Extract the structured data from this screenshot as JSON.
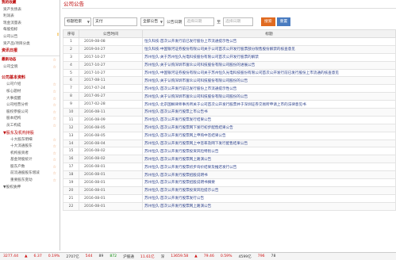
{
  "sidebar": {
    "top_items": [
      {
        "label": "我的收藏",
        "bold": true
      },
      {
        "label": "资产负债表"
      },
      {
        "label": "利润表"
      },
      {
        "label": "现金流量表"
      },
      {
        "label": "每股指标"
      },
      {
        "label": "公司公告"
      },
      {
        "label": "资产品/项目分类"
      }
    ],
    "info_section": "资讯日报",
    "mid_items": [
      {
        "label": "最新动态",
        "bold": true,
        "star": true
      },
      {
        "label": "公司全貌",
        "star": true
      }
    ],
    "basic_section": "公司基本资料",
    "basic_items": [
      {
        "label": "公司介绍",
        "star": true
      },
      {
        "label": "核心题材",
        "star": true
      },
      {
        "label": "大事提醒",
        "star": true
      },
      {
        "label": "公司经营分析",
        "star": true
      },
      {
        "label": "股权参股公司",
        "star": true
      },
      {
        "label": "股本结构",
        "star": true
      },
      {
        "label": "员工构成",
        "star": true
      }
    ],
    "shareholder_section": "▼股东及机构持股",
    "shareholder_items": [
      {
        "label": "十大股东明细",
        "star": true
      },
      {
        "label": "十大流通股东",
        "star": true
      },
      {
        "label": "机构投资者",
        "star": true
      },
      {
        "label": "基金持股统计",
        "star": true
      },
      {
        "label": "股东户数",
        "star": true
      },
      {
        "label": "前流通股股东增减",
        "star": true
      },
      {
        "label": "重要股东变动",
        "star": true
      }
    ],
    "bottom_item": "▼股权质押",
    "scroll_marker": "⇕"
  },
  "main": {
    "title": "公司公告",
    "filters": {
      "field_select": "标题检索",
      "keyword": "支付",
      "category_select": "全部公告",
      "date_label": "公告日期",
      "start_date_placeholder": "选择日期",
      "to_label": "至",
      "end_date_placeholder": "选择日期",
      "search_button": "搜索",
      "reset_button": "重置"
    },
    "table": {
      "headers": [
        "序号",
        "公告时间",
        "标题"
      ],
      "rows": [
        {
          "num": "1",
          "date": "2019-08-08",
          "title": "恒久科技:首次公开发行前已发行股份上市流通提示性公告"
        },
        {
          "num": "2",
          "date": "2019-04-27",
          "title": "恒久科技:中国银河证券股份有限公司关于公司首次公开发行股票部分限售股份解禁的核查意见"
        },
        {
          "num": "3",
          "date": "2017-10-27",
          "title": "苏州恒久:关于苏州恒久光电科技股份有限公司首次公开发行股票的解禁"
        },
        {
          "num": "4",
          "date": "2017-10-27",
          "title": "苏州恒久:关于认购深圳市富众公司科技股份有限公司股份的进展公告"
        },
        {
          "num": "5",
          "date": "2017-10-27",
          "title": "苏州恒久:中国银河证券股份有限公司关于苏州恒久光电科技股份有限公司首次公开发行前已发行股份上市流通的核查意见"
        },
        {
          "num": "6",
          "date": "2017-08-11",
          "title": "苏州恒久:关于认购深圳市富众公司科技股份有限公司股份的公告"
        },
        {
          "num": "7",
          "date": "2017-07-24",
          "title": "苏州恒久:首次公开发行前已发行股份上市流通提示性公告"
        },
        {
          "num": "8",
          "date": "2017-06-27",
          "title": "苏州恒久:关于认购深圳市富众公司科技股份有限公司股份的公告"
        },
        {
          "num": "9",
          "date": "2017-02-28",
          "title": "苏州恒久:北京国枫律师事务所关于公司首次公开发行股票并于深圳证券交易所申请上市的法律意见书"
        },
        {
          "num": "10",
          "date": "2016-08-11",
          "title": "苏州恒久:首次公开发行股票上市公告书"
        },
        {
          "num": "11",
          "date": "2016-08-09",
          "title": "苏州恒久:首次公开发行股票发行结果公告"
        },
        {
          "num": "12",
          "date": "2016-08-05",
          "title": "苏州恒久:首次公开发行股票网下发行初步配售结果公告"
        },
        {
          "num": "13",
          "date": "2016-08-05",
          "title": "苏州恒久:首次公开发行股票网上申购中签结果公告"
        },
        {
          "num": "14",
          "date": "2016-08-04",
          "title": "苏州恒久:首次公开发行股票网上中签率及网下发行配售结果公告"
        },
        {
          "num": "15",
          "date": "2016-08-02",
          "title": "苏州恒久:首次公开发行股票投资风险特别公告"
        },
        {
          "num": "16",
          "date": "2016-08-02",
          "title": "苏州恒久:首次公开发行股票网上路演公告"
        },
        {
          "num": "17",
          "date": "2016-08-01",
          "title": "苏州恒久:首次公开发行股票初步询价结果及推迟发行公告"
        },
        {
          "num": "18",
          "date": "2016-08-01",
          "title": "苏州恒久:首次公开发行股票招股说明书"
        },
        {
          "num": "19",
          "date": "2016-08-01",
          "title": "苏州恒久:首次公开发行股票招股说明书摘要"
        },
        {
          "num": "20",
          "date": "2016-08-01",
          "title": "苏州恒久:首次公开发行股票投资风险提示公告"
        },
        {
          "num": "21",
          "date": "2016-08-01",
          "title": "苏州恒久:首次公开发行股票发行公告"
        },
        {
          "num": "22",
          "date": "2016-08-01",
          "title": "苏州恒久:首次公开发行股票网上路演公告"
        }
      ]
    }
  },
  "ticker": [
    {
      "text": "3277.44",
      "tone": "up"
    },
    {
      "text": "▲",
      "tone": "up"
    },
    {
      "text": "6.37",
      "tone": "up"
    },
    {
      "text": "0.19%",
      "tone": "up"
    },
    {
      "text": "2707亿",
      "tone": "neutral"
    },
    {
      "text": "544",
      "tone": "up"
    },
    {
      "text": "89",
      "tone": "neutral"
    },
    {
      "text": "872",
      "tone": "down"
    },
    {
      "text": "沪股通",
      "tone": "neutral"
    },
    {
      "text": "11.61亿",
      "tone": "up"
    },
    {
      "text": "深",
      "tone": "neutral"
    },
    {
      "text": "13659.58",
      "tone": "up"
    },
    {
      "text": "▲",
      "tone": "up"
    },
    {
      "text": "79.46",
      "tone": "up"
    },
    {
      "text": "0.59%",
      "tone": "up"
    },
    {
      "text": "4599亿",
      "tone": "neutral"
    },
    {
      "text": "796",
      "tone": "up"
    },
    {
      "text": "78",
      "tone": "neutral"
    }
  ]
}
